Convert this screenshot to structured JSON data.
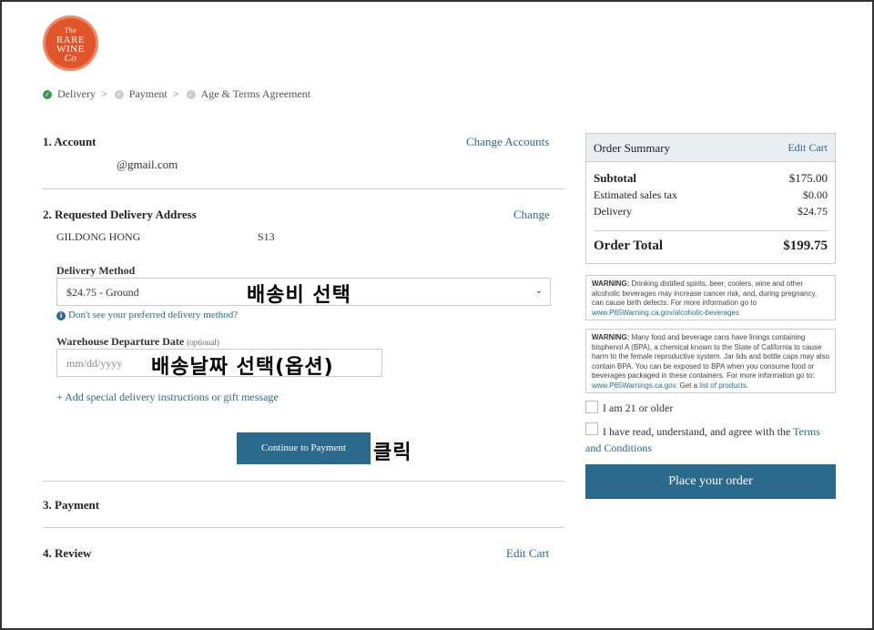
{
  "logo": {
    "line1": "The",
    "line2": "RARE",
    "line3": "WINE",
    "line4": "Co"
  },
  "breadcrumb": {
    "step1": "Delivery",
    "step2": "Payment",
    "step3": "Age & Terms Agreement",
    "sep": ">"
  },
  "account": {
    "title": "1. Account",
    "change_label": "Change Accounts",
    "email": "@gmail.com"
  },
  "address": {
    "title": "2. Requested Delivery Address",
    "change_label": "Change",
    "name": "GILDONG HONG",
    "code": "S13"
  },
  "delivery_method": {
    "label": "Delivery Method",
    "selected": "$24.75 - Ground",
    "help_link": "Don't see your preferred delivery method?"
  },
  "departure": {
    "label": "Warehouse Departure Date",
    "optional": "(optional)",
    "placeholder": "mm/dd/yyyy"
  },
  "instructions_link": "+ Add special delivery instructions or gift message",
  "continue_label": "Continue to Payment",
  "annotations": {
    "shipping": "배송비 선택",
    "date": "배송날짜 선택(옵션)",
    "click": "클릭"
  },
  "payment": {
    "title": "3. Payment"
  },
  "review": {
    "title": "4. Review",
    "edit_label": "Edit Cart"
  },
  "summary": {
    "title": "Order Summary",
    "edit_label": "Edit Cart",
    "subtotal_label": "Subtotal",
    "subtotal": "$175.00",
    "tax_label": "Estimated sales tax",
    "tax": "$0.00",
    "delivery_label": "Delivery",
    "delivery": "$24.75",
    "total_label": "Order Total",
    "total": "$199.75"
  },
  "warning1": {
    "head": "WARNING:",
    "text": "Drinking distilled spirits, beer, coolers, wine and other alcoholic beverages may increase cancer risk, and, during pregnancy, can cause birth defects. For more information go to",
    "link": "www.P65Warning.ca.gov/alcoholic-beverages"
  },
  "warning2": {
    "head": "WARNING:",
    "text": "Many food and beverage cans have linings containing bisphenol A (BPA), a chemical known to the State of California to cause harm to the female reproductive system. Jar lids and bottle caps may also contain BPA. You can be exposed to BPA when you consume food or beverages packaged in these containers. For more information go to:",
    "link1": "www.P65Warnings.ca.gov",
    "mid": ". Get a",
    "link2": "list of products",
    "end": "."
  },
  "age_check": "I am 21 or older",
  "terms_check": {
    "text": "I have read, understand, and agree with the",
    "link": "Terms and Conditions"
  },
  "place_order": "Place your order"
}
